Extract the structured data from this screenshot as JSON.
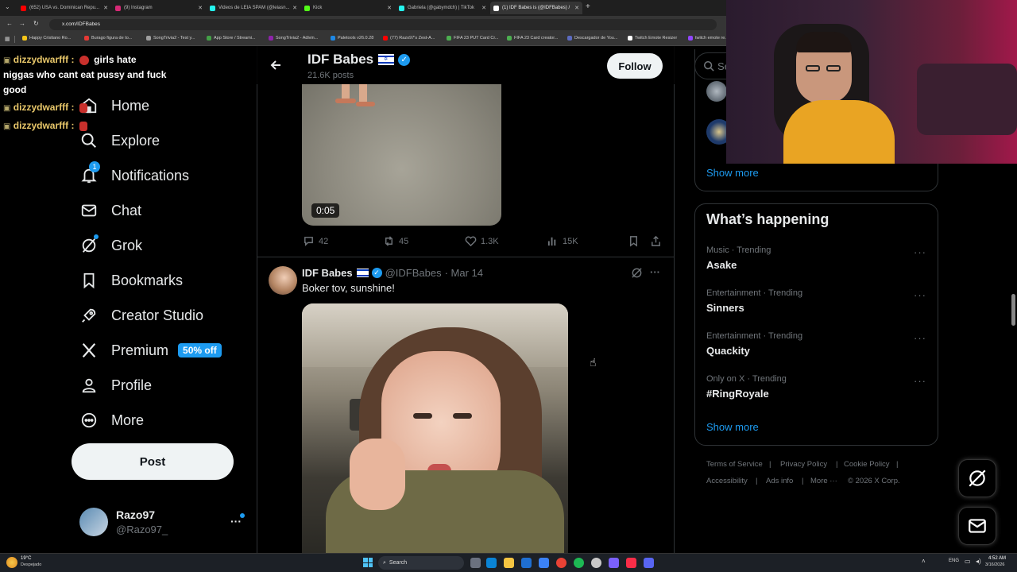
{
  "browser": {
    "tabs": [
      {
        "label": "(652) USA vs. Dominican Repu...",
        "color": "#ff0000"
      },
      {
        "label": "(9) Instagram",
        "color": "#d62976"
      },
      {
        "label": "Videos de LEIA SPAM (@leiasn...",
        "color": "#222222"
      },
      {
        "label": "Kick",
        "color": "#53fc18"
      },
      {
        "label": "Gabriela (@gabymdch) | TikTok",
        "color": "#222222"
      },
      {
        "label": "(1) IDF Babes is (@IDFBabes) /",
        "color": "#000000"
      }
    ],
    "url": "x.com/IDFBabes",
    "bookmarks": [
      "Happy Cristiano Ro...",
      "Burago figura de to...",
      "SongTrivia2 - Test y...",
      "App Store / Streami...",
      "SongTrivia2 - Adivin...",
      "Paletools v26.0.28",
      "(77) Razo97's Zest-A...",
      "FIFA 23 PUT Card Cr...",
      "FIFA 23 Card creator...",
      "Descargador de You...",
      "Twitch Emote Resizer",
      "twitch emote re..."
    ]
  },
  "chat": [
    {
      "user": "dizzydwarfff :",
      "message": "girls hate"
    },
    {
      "user": "",
      "message": "niggas who cant eat pussy and fuck"
    },
    {
      "user": "",
      "message": "good"
    },
    {
      "user": "dizzydwarfff :",
      "message": ""
    },
    {
      "user": "dizzydwarfff :",
      "message": ""
    }
  ],
  "nav": {
    "home": "Home",
    "explore": "Explore",
    "notifications": "Notifications",
    "notifications_badge": "1",
    "chat": "Chat",
    "grok": "Grok",
    "bookmarks": "Bookmarks",
    "creator_studio": "Creator Studio",
    "premium": "Premium",
    "premium_badge": "50% off",
    "profile": "Profile",
    "more": "More",
    "post": "Post"
  },
  "account": {
    "name": "Razo97",
    "handle": "@Razo97_"
  },
  "profile_header": {
    "name": "IDF Babes",
    "flag": "🇮🇱",
    "posts": "21.6K posts",
    "follow": "Follow"
  },
  "tweet1": {
    "video_time": "0:05",
    "replies": "42",
    "reposts": "45",
    "likes": "1.3K",
    "views": "15K"
  },
  "tweet2": {
    "name": "IDF Babes",
    "flag": "🇮🇱",
    "handle": "@IDFBabes",
    "date": "· Mar 14",
    "text": "Boker tov, sunshine!"
  },
  "sidebar": {
    "search_placeholder": "Se",
    "show_more_1": "Show more",
    "happening_title": "What’s happening",
    "trends": [
      {
        "meta": "Music · Trending",
        "name": "Asake"
      },
      {
        "meta": "Entertainment · Trending",
        "name": "Sinners"
      },
      {
        "meta": "Entertainment · Trending",
        "name": "Quackity"
      },
      {
        "meta": "Only on X · Trending",
        "name": "#RingRoyale"
      }
    ],
    "show_more_2": "Show more",
    "footer": [
      "Terms of Service",
      "|",
      "Privacy Policy",
      "|",
      "Cookie Policy",
      "|",
      "Accessibility",
      "|",
      "Ads info",
      "|",
      "More ···",
      "© 2026 X Corp."
    ]
  },
  "taskbar": {
    "weather_temp": "19°C",
    "weather_desc": "Despejado",
    "search": "Search",
    "lang": "ENG",
    "time": "4:52 AM",
    "date": "3/16/2026"
  },
  "colors": {
    "accent": "#1d9bf0",
    "bg": "#000000",
    "border": "#2f3336",
    "muted": "#71767b"
  }
}
